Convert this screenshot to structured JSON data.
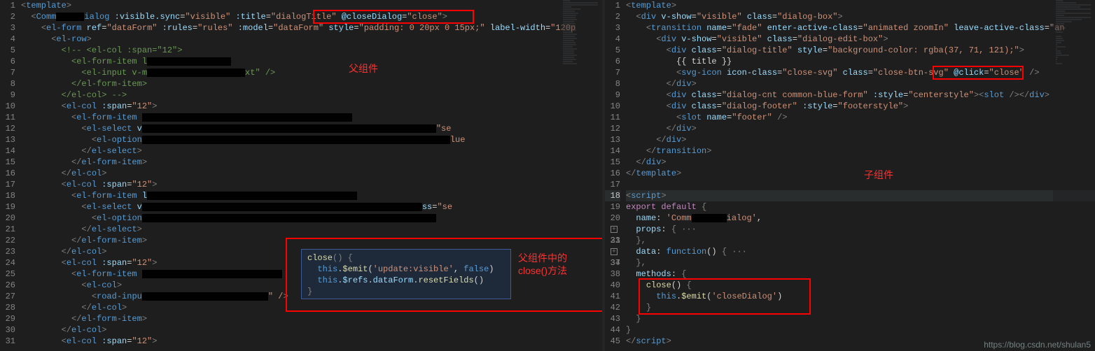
{
  "left": {
    "label_parent": "父组件",
    "label_close_method": "父组件中的\nclose()方法",
    "highlight_attr": "@closeDialog=\"close\"",
    "lines": [
      {
        "n": 1,
        "html": "<span class='t-punc'>&lt;</span><span class='t-tag'>template</span><span class='t-punc'>&gt;</span>"
      },
      {
        "n": 2,
        "html": "  <span class='t-punc'>&lt;</span><span class='t-tag'>Comm</span><span class='redact' style='width:40px'></span><span class='t-tag'>ialog</span> <span class='t-attr'>:visible.sync</span>=<span class='t-str'>\"visible\"</span> <span class='t-attr'>:title</span>=<span class='t-str'>\"dialogTitle\"</span> <span class='t-attr'>@closeDialog</span>=<span class='t-str'>\"close\"</span><span class='t-punc'>&gt;</span>"
      },
      {
        "n": 3,
        "html": "    <span class='t-punc'>&lt;</span><span class='t-tag'>el-form</span> <span class='t-attr'>ref</span>=<span class='t-str'>\"dataForm\"</span> <span class='t-attr'>:rules</span>=<span class='t-str'>\"rules\"</span> <span class='t-attr'>:model</span>=<span class='t-str'>\"dataForm\"</span> <span class='t-attr'>style</span>=<span class='t-str'>\"padding: 0 20px 0 15px;\"</span> <span class='t-attr'>label-width</span>=<span class='t-str'>\"120p</span>"
      },
      {
        "n": 4,
        "html": "      <span class='t-punc'>&lt;</span><span class='t-tag'>el-row</span><span class='t-punc'>&gt;</span>"
      },
      {
        "n": 5,
        "html": "        <span class='t-comment'>&lt;!-- &lt;el-col :span=\"12\"&gt;</span>"
      },
      {
        "n": 6,
        "html": "          <span class='t-comment'>&lt;el-form-item l</span><span class='redact' style='width:120px'></span>"
      },
      {
        "n": 7,
        "html": "            <span class='t-comment'>&lt;el-input v-m</span><span class='redact' style='width:140px'></span><span class='t-comment'>xt\" /&gt;</span>"
      },
      {
        "n": 8,
        "html": "          <span class='t-comment'>&lt;/el-form-item&gt;</span>"
      },
      {
        "n": 9,
        "html": "        <span class='t-comment'>&lt;/el-col&gt; --&gt;</span>"
      },
      {
        "n": 10,
        "html": "        <span class='t-punc'>&lt;</span><span class='t-tag'>el-col</span> <span class='t-attr'>:span</span>=<span class='t-str'>\"12\"</span><span class='t-punc'>&gt;</span>"
      },
      {
        "n": 11,
        "html": "          <span class='t-punc'>&lt;</span><span class='t-tag'>el-form-item</span> <span class='redact' style='width:300px'></span>"
      },
      {
        "n": 12,
        "html": "            <span class='t-punc'>&lt;</span><span class='t-tag'>el-select</span> <span class='t-attr'>v</span><span class='redact' style='width:420px'></span><span class='t-str'>\"se</span>"
      },
      {
        "n": 13,
        "html": "              <span class='t-punc'>&lt;</span><span class='t-tag'>el-option</span><span class='redact' style='width:440px'></span><span class='t-str'>lue</span>"
      },
      {
        "n": 14,
        "html": "            <span class='t-punc'>&lt;/</span><span class='t-tag'>el-select</span><span class='t-punc'>&gt;</span>"
      },
      {
        "n": 15,
        "html": "          <span class='t-punc'>&lt;/</span><span class='t-tag'>el-form-item</span><span class='t-punc'>&gt;</span>"
      },
      {
        "n": 16,
        "html": "        <span class='t-punc'>&lt;/</span><span class='t-tag'>el-col</span><span class='t-punc'>&gt;</span>"
      },
      {
        "n": 17,
        "html": "        <span class='t-punc'>&lt;</span><span class='t-tag'>el-col</span> <span class='t-attr'>:span</span>=<span class='t-str'>\"12\"</span><span class='t-punc'>&gt;</span>"
      },
      {
        "n": 18,
        "html": "          <span class='t-punc'>&lt;</span><span class='t-tag'>el-form-item</span> <span class='t-attr'>l</span><span class='redact' style='width:300px'></span>"
      },
      {
        "n": 19,
        "html": "            <span class='t-punc'>&lt;</span><span class='t-tag'>el-select</span> <span class='t-attr'>v</span><span class='redact' style='width:400px'></span><span class='t-attr'>ss</span>=<span class='t-str'>\"se</span>"
      },
      {
        "n": 20,
        "html": "              <span class='t-punc'>&lt;</span><span class='t-tag'>el-option</span><span class='redact' style='width:420px'></span>"
      },
      {
        "n": 21,
        "html": "            <span class='t-punc'>&lt;/</span><span class='t-tag'>el-select</span><span class='t-punc'>&gt;</span>"
      },
      {
        "n": 22,
        "html": "          <span class='t-punc'>&lt;/</span><span class='t-tag'>el-form-item</span><span class='t-punc'>&gt;</span>"
      },
      {
        "n": 23,
        "html": "        <span class='t-punc'>&lt;/</span><span class='t-tag'>el-col</span><span class='t-punc'>&gt;</span>"
      },
      {
        "n": 24,
        "html": "        <span class='t-punc'>&lt;</span><span class='t-tag'>el-col</span> <span class='t-attr'>:span</span>=<span class='t-str'>\"12\"</span><span class='t-punc'>&gt;</span>"
      },
      {
        "n": 25,
        "html": "          <span class='t-punc'>&lt;</span><span class='t-tag'>el-form-item</span> <span class='redact' style='width:200px'></span>"
      },
      {
        "n": 26,
        "html": "            <span class='t-punc'>&lt;</span><span class='t-tag'>el-col</span><span class='t-punc'>&gt;</span>"
      },
      {
        "n": 27,
        "html": "              <span class='t-punc'>&lt;</span><span class='t-tag'>road-inpu</span><span class='redact' style='width:180px'></span><span class='t-str'>\" /</span><span class='t-punc'>&gt;</span>"
      },
      {
        "n": 28,
        "html": "            <span class='t-punc'>&lt;/</span><span class='t-tag'>el-col</span><span class='t-punc'>&gt;</span>"
      },
      {
        "n": 29,
        "html": "          <span class='t-punc'>&lt;/</span><span class='t-tag'>el-form-item</span><span class='t-punc'>&gt;</span>"
      },
      {
        "n": 30,
        "html": "        <span class='t-punc'>&lt;/</span><span class='t-tag'>el-col</span><span class='t-punc'>&gt;</span>"
      },
      {
        "n": 31,
        "html": "        <span class='t-punc'>&lt;</span><span class='t-tag'>el-col</span> <span class='t-attr'>:span</span>=<span class='t-str'>\"12\"</span><span class='t-punc'>&gt;</span>"
      }
    ],
    "popup_lines": [
      "<span class='t-fn'>close</span><span class='t-punc'>()</span> <span class='t-punc'>{</span>",
      "  <span class='t-this'>this</span>.<span class='t-fn'>$emit</span>(<span class='t-str'>'update:visible'</span>, <span class='t-bool'>false</span>)",
      "  <span class='t-this'>this</span>.<span class='t-prop'>$refs</span>.<span class='t-prop'>dataForm</span>.<span class='t-fn'>resetFields</span>()",
      "<span class='t-punc'>}</span>"
    ]
  },
  "right": {
    "label_child": "子组件",
    "highlight_attr": "@click=\"close\"",
    "lines": [
      {
        "n": 1,
        "html": "<span class='t-punc'>&lt;</span><span class='t-tag'>template</span><span class='t-punc'>&gt;</span>"
      },
      {
        "n": 2,
        "html": "  <span class='t-punc'>&lt;</span><span class='t-tag'>div</span> <span class='t-attr'>v-show</span>=<span class='t-str'>\"visible\"</span> <span class='t-attr'>class</span>=<span class='t-str'>\"dialog-box\"</span><span class='t-punc'>&gt;</span>"
      },
      {
        "n": 3,
        "html": "    <span class='t-punc'>&lt;</span><span class='t-tag'>transition</span> <span class='t-attr'>name</span>=<span class='t-str'>\"fade\"</span> <span class='t-attr'>enter-active-class</span>=<span class='t-str'>\"animated zoomIn\"</span> <span class='t-attr'>leave-active-class</span>=<span class='t-str'>\"an</span>"
      },
      {
        "n": 4,
        "html": "      <span class='t-punc'>&lt;</span><span class='t-tag'>div</span> <span class='t-attr'>v-show</span>=<span class='t-str'>\"visible\"</span> <span class='t-attr'>class</span>=<span class='t-str'>\"dialog-edit-box\"</span><span class='t-punc'>&gt;</span>"
      },
      {
        "n": 5,
        "html": "        <span class='t-punc'>&lt;</span><span class='t-tag'>div</span> <span class='t-attr'>class</span>=<span class='t-str'>\"dialog-title\"</span> <span class='t-attr'>style</span>=<span class='t-str'>\"background-color: rgba(37, 71, 121);\"</span><span class='t-punc'>&gt;</span>"
      },
      {
        "n": 6,
        "html": "          <span class='t-plain'>{{ title }}</span>"
      },
      {
        "n": 7,
        "html": "          <span class='t-punc'>&lt;</span><span class='t-tag'>svg-icon</span> <span class='t-attr'>icon-class</span>=<span class='t-str'>\"close-svg\"</span> <span class='t-attr'>class</span>=<span class='t-str'>\"close-btn-svg\"</span> <span class='t-attr'>@click</span>=<span class='t-str'>\"close\"</span> <span class='t-punc'>/&gt;</span>"
      },
      {
        "n": 8,
        "html": "        <span class='t-punc'>&lt;/</span><span class='t-tag'>div</span><span class='t-punc'>&gt;</span>"
      },
      {
        "n": 9,
        "html": "        <span class='t-punc'>&lt;</span><span class='t-tag'>div</span> <span class='t-attr'>class</span>=<span class='t-str'>\"dialog-cnt common-blue-form\"</span> <span class='t-attr'>:style</span>=<span class='t-str'>\"centerstyle\"</span><span class='t-punc'>&gt;&lt;</span><span class='t-tag'>slot</span> <span class='t-punc'>/&gt;&lt;/</span><span class='t-tag'>div</span><span class='t-punc'>&gt;</span>"
      },
      {
        "n": 10,
        "html": "        <span class='t-punc'>&lt;</span><span class='t-tag'>div</span> <span class='t-attr'>class</span>=<span class='t-str'>\"dialog-footer\"</span> <span class='t-attr'>:style</span>=<span class='t-str'>\"footerstyle\"</span><span class='t-punc'>&gt;</span>"
      },
      {
        "n": 11,
        "html": "          <span class='t-punc'>&lt;</span><span class='t-tag'>slot</span> <span class='t-attr'>name</span>=<span class='t-str'>\"footer\"</span> <span class='t-punc'>/&gt;</span>"
      },
      {
        "n": 12,
        "html": "        <span class='t-punc'>&lt;/</span><span class='t-tag'>div</span><span class='t-punc'>&gt;</span>"
      },
      {
        "n": 13,
        "html": "      <span class='t-punc'>&lt;/</span><span class='t-tag'>div</span><span class='t-punc'>&gt;</span>"
      },
      {
        "n": 14,
        "html": "    <span class='t-punc'>&lt;/</span><span class='t-tag'>transition</span><span class='t-punc'>&gt;</span>"
      },
      {
        "n": 15,
        "html": "  <span class='t-punc'>&lt;/</span><span class='t-tag'>div</span><span class='t-punc'>&gt;</span>"
      },
      {
        "n": 16,
        "html": "<span class='t-punc'>&lt;/</span><span class='t-tag'>template</span><span class='t-punc'>&gt;</span>"
      },
      {
        "n": 17,
        "html": ""
      },
      {
        "n": 18,
        "hl": true,
        "html": "<span class='t-punc'>&lt;</span><span class='t-tag'>script</span><span class='t-punc'>&gt;</span>"
      },
      {
        "n": 19,
        "html": "<span class='t-kw2'>export</span> <span class='t-kw2'>default</span> <span class='t-punc'>{</span>"
      },
      {
        "n": 20,
        "html": "  <span class='t-prop'>name</span>: <span class='t-str'>'Comm</span><span class='redact' style='width:50px'></span><span class='t-str'>ialog'</span>,"
      },
      {
        "n": 21,
        "fold": true,
        "html": "  <span class='t-prop'>props</span>: <span class='t-punc'>{</span> <span class='t-punc'>···</span>"
      },
      {
        "n": 33,
        "html": "  <span class='t-punc'>},</span>"
      },
      {
        "n": 34,
        "fold": true,
        "html": "  <span class='t-prop'>data</span>: <span class='t-kw'>function</span>() <span class='t-punc'>{</span> <span class='t-punc'>···</span>"
      },
      {
        "n": 37,
        "html": "  <span class='t-punc'>},</span>"
      },
      {
        "n": 38,
        "html": "  <span class='t-prop'>methods</span>: <span class='t-punc'>{</span>"
      },
      {
        "n": 40,
        "html": "    <span class='t-fn'>close</span>() <span class='t-punc'>{</span>"
      },
      {
        "n": 41,
        "html": "      <span class='t-this'>this</span>.<span class='t-fn'>$emit</span>(<span class='t-str'>'closeDialog'</span>)"
      },
      {
        "n": 42,
        "html": "    <span class='t-punc'>}</span>"
      },
      {
        "n": 43,
        "html": "  <span class='t-punc'>}</span>"
      },
      {
        "n": 44,
        "html": "<span class='t-punc'>}</span>"
      },
      {
        "n": 45,
        "html": "<span class='t-punc'>&lt;/</span><span class='t-tag'>script</span><span class='t-punc'>&gt;</span>"
      }
    ]
  },
  "watermark": "https://blog.csdn.net/shulan5"
}
